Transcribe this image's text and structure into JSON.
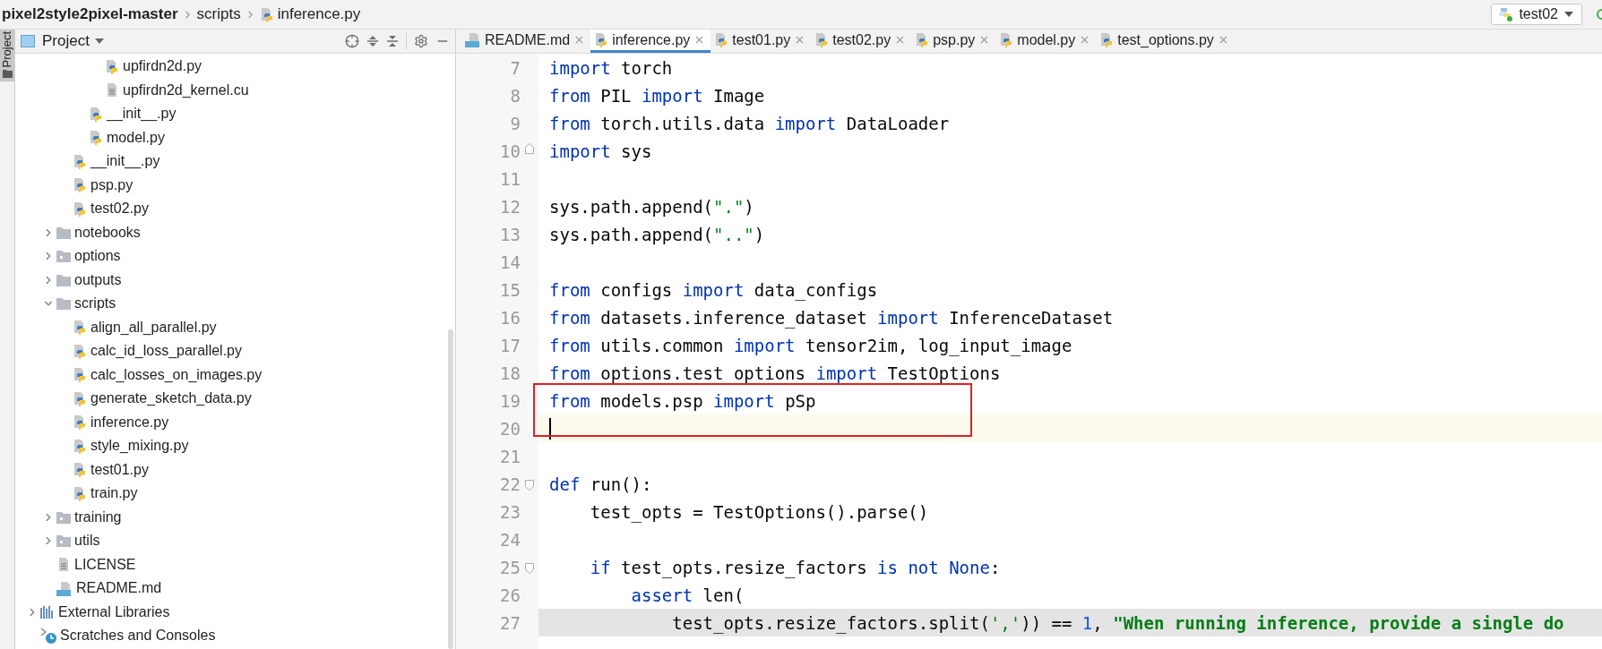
{
  "breadcrumb": [
    {
      "label": "pixel2style2pixel-master",
      "kind": "root"
    },
    {
      "label": "scripts",
      "kind": "folder"
    },
    {
      "label": "inference.py",
      "kind": "python"
    }
  ],
  "run_config": {
    "label": "test02"
  },
  "side_strip": {
    "label": "Project"
  },
  "project_panel": {
    "title": "Project"
  },
  "project_tree": [
    {
      "children": [
        {
          "children": [
            {
              "children": [
                {
                  "children": [
                    {
                      "label": "upfirdn2d.py",
                      "kind": "python"
                    },
                    {
                      "label": "upfirdn2d_kernel.cu",
                      "kind": "text"
                    }
                  ]
                },
                {
                  "label": "__init__.py",
                  "kind": "python"
                },
                {
                  "label": "model.py",
                  "kind": "python"
                }
              ]
            },
            {
              "label": "__init__.py",
              "kind": "python"
            },
            {
              "label": "psp.py",
              "kind": "python"
            },
            {
              "label": "test02.py",
              "kind": "python"
            }
          ]
        },
        {
          "label": "notebooks",
          "kind": "folder",
          "expanded": false
        },
        {
          "label": "options",
          "kind": "package",
          "expanded": false
        },
        {
          "label": "outputs",
          "kind": "folder",
          "expanded": false
        },
        {
          "label": "scripts",
          "kind": "folder",
          "expanded": true,
          "children": [
            {
              "label": "align_all_parallel.py",
              "kind": "python"
            },
            {
              "label": "calc_id_loss_parallel.py",
              "kind": "python"
            },
            {
              "label": "calc_losses_on_images.py",
              "kind": "python"
            },
            {
              "label": "generate_sketch_data.py",
              "kind": "python"
            },
            {
              "label": "inference.py",
              "kind": "python"
            },
            {
              "label": "style_mixing.py",
              "kind": "python"
            },
            {
              "label": "test01.py",
              "kind": "python"
            },
            {
              "label": "train.py",
              "kind": "python"
            }
          ]
        },
        {
          "label": "training",
          "kind": "package",
          "expanded": false
        },
        {
          "label": "utils",
          "kind": "package",
          "expanded": false
        },
        {
          "label": "LICENSE",
          "kind": "text"
        },
        {
          "label": "README.md",
          "kind": "markdown"
        }
      ]
    },
    {
      "label": "External Libraries",
      "kind": "libraries",
      "expanded": false
    },
    {
      "label": "Scratches and Consoles",
      "kind": "scratches"
    }
  ],
  "tabs": [
    {
      "label": "README.md",
      "kind": "markdown",
      "selected": false
    },
    {
      "label": "inference.py",
      "kind": "python",
      "selected": true
    },
    {
      "label": "test01.py",
      "kind": "python",
      "selected": false
    },
    {
      "label": "test02.py",
      "kind": "python",
      "selected": false
    },
    {
      "label": "psp.py",
      "kind": "python",
      "selected": false
    },
    {
      "label": "model.py",
      "kind": "python",
      "selected": false
    },
    {
      "label": "test_options.py",
      "kind": "python",
      "selected": false
    }
  ],
  "code_lines": [
    {
      "number": "7",
      "caret": false,
      "shaded": false,
      "fold_start": false,
      "fold_end": false,
      "boxed": false,
      "tokens": [
        {
          "kind": "keyword",
          "text": "import"
        },
        {
          "kind": "plain",
          "text": " torch"
        }
      ]
    },
    {
      "number": "8",
      "caret": false,
      "shaded": false,
      "fold_start": false,
      "fold_end": false,
      "boxed": false,
      "tokens": [
        {
          "kind": "keyword",
          "text": "from"
        },
        {
          "kind": "plain",
          "text": " PIL "
        },
        {
          "kind": "keyword",
          "text": "import"
        },
        {
          "kind": "plain",
          "text": " Image"
        }
      ]
    },
    {
      "number": "9",
      "caret": false,
      "shaded": false,
      "fold_start": false,
      "fold_end": false,
      "boxed": false,
      "tokens": [
        {
          "kind": "keyword",
          "text": "from"
        },
        {
          "kind": "plain",
          "text": " torch.utils.data "
        },
        {
          "kind": "keyword",
          "text": "import"
        },
        {
          "kind": "plain",
          "text": " DataLoader"
        }
      ]
    },
    {
      "number": "10",
      "caret": false,
      "shaded": false,
      "fold_start": false,
      "fold_end": true,
      "boxed": false,
      "tokens": [
        {
          "kind": "keyword",
          "text": "import"
        },
        {
          "kind": "plain",
          "text": " sys"
        }
      ]
    },
    {
      "number": "11",
      "caret": false,
      "shaded": false,
      "fold_start": false,
      "fold_end": false,
      "boxed": false
    },
    {
      "number": "12",
      "caret": false,
      "shaded": false,
      "fold_start": false,
      "fold_end": false,
      "boxed": false,
      "tokens": [
        {
          "kind": "plain",
          "text": "sys.path.append("
        },
        {
          "kind": "string",
          "text": "\".\""
        },
        {
          "kind": "plain",
          "text": ")"
        }
      ]
    },
    {
      "number": "13",
      "caret": false,
      "shaded": false,
      "fold_start": false,
      "fold_end": false,
      "boxed": false,
      "tokens": [
        {
          "kind": "plain",
          "text": "sys.path.append("
        },
        {
          "kind": "string",
          "text": "\"..\""
        },
        {
          "kind": "plain",
          "text": ")"
        }
      ]
    },
    {
      "number": "14",
      "caret": false,
      "shaded": false,
      "fold_start": false,
      "fold_end": false,
      "boxed": false
    },
    {
      "number": "15",
      "caret": false,
      "shaded": false,
      "fold_start": false,
      "fold_end": false,
      "boxed": false,
      "tokens": [
        {
          "kind": "keyword",
          "text": "from"
        },
        {
          "kind": "plain",
          "text": " configs "
        },
        {
          "kind": "keyword",
          "text": "import"
        },
        {
          "kind": "plain",
          "text": " data_configs"
        }
      ]
    },
    {
      "number": "16",
      "caret": false,
      "shaded": false,
      "fold_start": false,
      "fold_end": false,
      "boxed": false,
      "tokens": [
        {
          "kind": "keyword",
          "text": "from"
        },
        {
          "kind": "plain",
          "text": " datasets.inference_dataset "
        },
        {
          "kind": "keyword",
          "text": "import"
        },
        {
          "kind": "plain",
          "text": " InferenceDataset"
        }
      ]
    },
    {
      "number": "17",
      "caret": false,
      "shaded": false,
      "fold_start": false,
      "fold_end": false,
      "boxed": false,
      "tokens": [
        {
          "kind": "keyword",
          "text": "from"
        },
        {
          "kind": "plain",
          "text": " utils.common "
        },
        {
          "kind": "keyword",
          "text": "import"
        },
        {
          "kind": "plain",
          "text": " tensor2im, log_input_image"
        }
      ]
    },
    {
      "number": "18",
      "caret": false,
      "shaded": false,
      "fold_start": false,
      "fold_end": false,
      "boxed": false,
      "tokens": [
        {
          "kind": "keyword",
          "text": "from"
        },
        {
          "kind": "plain",
          "text": " options.test_options "
        },
        {
          "kind": "keyword",
          "text": "import"
        },
        {
          "kind": "plain",
          "text": " TestOptions"
        }
      ]
    },
    {
      "number": "19",
      "caret": false,
      "shaded": false,
      "fold_start": false,
      "fold_end": false,
      "boxed": true,
      "tokens": [
        {
          "kind": "keyword",
          "text": "from"
        },
        {
          "kind": "plain",
          "text": " models.psp "
        },
        {
          "kind": "keyword",
          "text": "import"
        },
        {
          "kind": "plain",
          "text": " pSp"
        }
      ]
    },
    {
      "number": "20",
      "caret": true,
      "shaded": false,
      "fold_start": false,
      "fold_end": false,
      "boxed": true
    },
    {
      "number": "21",
      "caret": false,
      "shaded": false,
      "fold_start": false,
      "fold_end": false,
      "boxed": false
    },
    {
      "number": "22",
      "caret": false,
      "shaded": false,
      "fold_start": true,
      "fold_end": false,
      "boxed": false,
      "tokens": [
        {
          "kind": "keyword",
          "text": "def"
        },
        {
          "kind": "plain",
          "text": " run():"
        }
      ]
    },
    {
      "number": "23",
      "caret": false,
      "shaded": false,
      "fold_start": false,
      "fold_end": false,
      "boxed": false,
      "tokens": [
        {
          "kind": "plain",
          "text": "    test_opts = TestOptions().parse()"
        }
      ]
    },
    {
      "number": "24",
      "caret": false,
      "shaded": false,
      "fold_start": false,
      "fold_end": false,
      "boxed": false
    },
    {
      "number": "25",
      "caret": false,
      "shaded": false,
      "fold_start": true,
      "fold_end": false,
      "boxed": false,
      "tokens": [
        {
          "kind": "keyword",
          "text": "    if"
        },
        {
          "kind": "plain",
          "text": " test_opts.resize_factors "
        },
        {
          "kind": "keyword",
          "text": "is not None"
        },
        {
          "kind": "plain",
          "text": ":"
        }
      ]
    },
    {
      "number": "26",
      "caret": false,
      "shaded": false,
      "fold_start": false,
      "fold_end": false,
      "boxed": false,
      "tokens": [
        {
          "kind": "keyword",
          "text": "        assert"
        },
        {
          "kind": "plain",
          "text": " len("
        }
      ]
    },
    {
      "number": "27",
      "caret": false,
      "shaded": true,
      "fold_start": false,
      "fold_end": false,
      "boxed": false,
      "tokens": [
        {
          "kind": "plain",
          "text": "            test_opts.resize_factors.split("
        },
        {
          "kind": "string",
          "text": "','"
        },
        {
          "kind": "plain",
          "text": ")) == "
        },
        {
          "kind": "number",
          "text": "1"
        },
        {
          "kind": "plain",
          "text": ", "
        },
        {
          "kind": "string",
          "text": "\"When running inference, provide a single do"
        }
      ]
    }
  ]
}
